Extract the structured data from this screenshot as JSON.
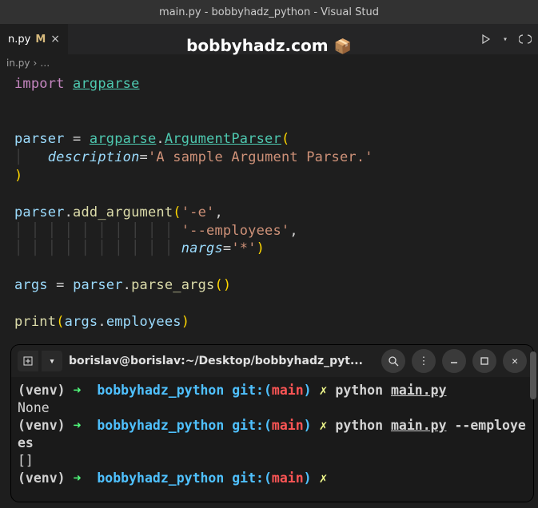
{
  "titlebar": "main.py - bobbyhadz_python - Visual Stud",
  "tab": {
    "name": "n.py",
    "modified": "M"
  },
  "overlay": {
    "text": "bobbyhadz.com",
    "icon": "📦"
  },
  "breadcrumb": {
    "file": "in.py",
    "sep": "›",
    "more": "…"
  },
  "code": {
    "l1_import": "import",
    "l1_mod": "argparse",
    "l2_var": "parser",
    "l2_eq": " = ",
    "l2_mod": "argparse",
    "l2_cls": "ArgumentParser",
    "l3_param": "description",
    "l3_str": "'A sample Argument Parser.'",
    "l4_var": "parser",
    "l4_fn": "add_argument",
    "l4_s1": "'-e'",
    "l5_s2": "'--employees'",
    "l6_param": "nargs",
    "l6_str": "'*'",
    "l7_var": "args",
    "l7_parser": "parser",
    "l7_fn": "parse_args",
    "l8_fn": "print",
    "l8_args": "args",
    "l8_emp": "employees"
  },
  "terminal": {
    "title": "borislav@borislav:~/Desktop/bobbyhadz_pyt...",
    "prompt": {
      "venv": "(venv)",
      "arrow": "➜",
      "dir": "bobbyhadz_python",
      "git": "git:(",
      "branch": "main",
      "gitclose": ")",
      "x": "✗"
    },
    "cmd1": {
      "python": "python",
      "file": "main.py"
    },
    "out1": "None",
    "cmd2": {
      "python": "python",
      "file": "main.py",
      "flag": "--employees"
    },
    "out2": "[]"
  }
}
